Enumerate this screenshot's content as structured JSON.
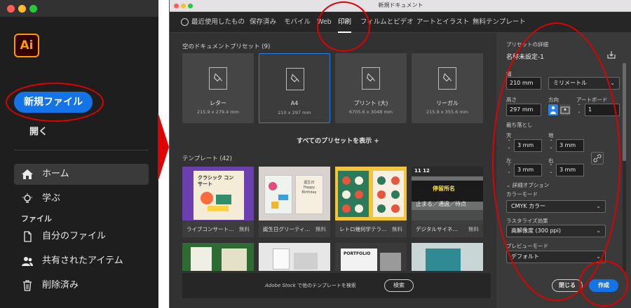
{
  "home": {
    "app_logo": "Ai",
    "new_file_button": "新規ファイル",
    "open_link": "開く",
    "nav": [
      {
        "label": "ホーム",
        "icon": "home-icon",
        "active": true
      },
      {
        "label": "学ぶ",
        "icon": "lightbulb-icon",
        "active": false
      }
    ],
    "files_section_label": "ファイル",
    "file_nav": [
      {
        "label": "自分のファイル",
        "icon": "document-icon"
      },
      {
        "label": "共有されたアイテム",
        "icon": "people-icon"
      },
      {
        "label": "削除済み",
        "icon": "trash-icon"
      }
    ]
  },
  "dialog": {
    "window_title": "新規ドキュメント",
    "tabs": [
      {
        "label": "最近使用したもの",
        "active": false
      },
      {
        "label": "保存済み",
        "active": false
      },
      {
        "label": "モバイル",
        "active": false
      },
      {
        "label": "Web",
        "active": false
      },
      {
        "label": "印刷",
        "active": true
      },
      {
        "label": "フィルムとビデオ",
        "active": false
      },
      {
        "label": "アートとイラスト",
        "active": false
      },
      {
        "label": "無料テンプレート",
        "active": false
      }
    ],
    "blank_presets_heading": "空のドキュメントプリセット",
    "blank_presets_count": "(9)",
    "presets": [
      {
        "name": "レター",
        "size": "215.9 x 279.4 mm",
        "selected": false
      },
      {
        "name": "A4",
        "size": "210 x 297 mm",
        "selected": true
      },
      {
        "name": "プリント (大)",
        "size": "6705.6 x 3048 mm",
        "selected": false
      },
      {
        "name": "リーガル",
        "size": "215.9 x 355.6 mm",
        "selected": false
      }
    ],
    "show_all_presets": "すべてのプリセットを表示 +",
    "templates_heading": "テンプレート",
    "templates_count": "(42)",
    "templates": [
      {
        "name": "ライブコンサート…",
        "price": "無料"
      },
      {
        "name": "誕生日グリーティ…",
        "price": "無料"
      },
      {
        "name": "レトロ幾何学テラ…",
        "price": "無料"
      },
      {
        "name": "デジタルサイネ…",
        "price": "無料"
      }
    ],
    "template_thumb_text": {
      "concert_title": "クラシック コンサート",
      "birthday_text": "誕生日 Happy Birthday",
      "digital_sign_sub": "止まる／通過／待点",
      "digital_sign_header": "11 12",
      "digital_sign_main": "停留所名",
      "portfolio": "PORTFOLIO"
    },
    "search_brand": "Adobe Stock",
    "search_text": "で他のテンプレートを検索",
    "search_button": "検索",
    "details": {
      "heading": "プリセットの詳細",
      "doc_name": "名称未設定-1",
      "width_label": "幅",
      "width_value": "210 mm",
      "unit_value": "ミリメートル",
      "height_label": "高さ",
      "height_value": "297 mm",
      "orientation_label": "方向",
      "artboard_label": "アートボード",
      "artboard_value": "1",
      "bleed_label": "裁ち落とし",
      "bleed_top_label": "天",
      "bleed_top": "3 mm",
      "bleed_bottom_label": "地",
      "bleed_bottom": "3 mm",
      "bleed_left_label": "左",
      "bleed_left": "3 mm",
      "bleed_right_label": "右",
      "bleed_right": "3 mm",
      "advanced_label": "詳細オプション",
      "color_mode_label": "カラーモード",
      "color_mode_value": "CMYK カラー",
      "raster_label": "ラスタライズ効果",
      "raster_value": "高解像度 (300 ppi)",
      "preview_label": "プレビューモード",
      "preview_value": "デフォルト"
    },
    "close_button": "閉じる",
    "create_button": "作成"
  },
  "colors": {
    "accent_blue": "#1473e6",
    "annotation_red": "#e00000",
    "ai_logo_orange": "#ff9a00"
  }
}
